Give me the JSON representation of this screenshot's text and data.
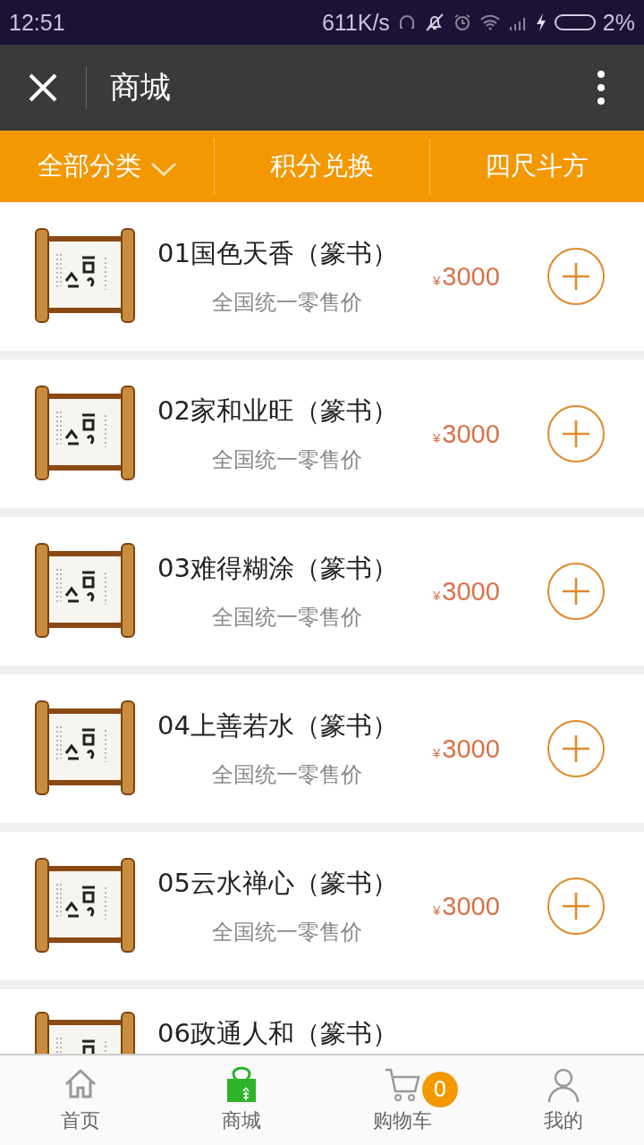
{
  "status_bar": {
    "time": "12:51",
    "speed": "611K/s",
    "battery": "2%"
  },
  "header": {
    "title": "商城"
  },
  "category_bar": [
    {
      "label": "全部分类",
      "kind": "dropdown"
    },
    {
      "label": "积分兑换",
      "kind": "link"
    },
    {
      "label": "四尺斗方",
      "kind": "link"
    }
  ],
  "products": [
    {
      "title": "01国色天香（篆书）",
      "subtitle": "全国统一零售价",
      "currency": "¥",
      "price": "3000"
    },
    {
      "title": "02家和业旺（篆书）",
      "subtitle": "全国统一零售价",
      "currency": "¥",
      "price": "3000"
    },
    {
      "title": "03难得糊涂（篆书）",
      "subtitle": "全国统一零售价",
      "currency": "¥",
      "price": "3000"
    },
    {
      "title": "04上善若水（篆书）",
      "subtitle": "全国统一零售价",
      "currency": "¥",
      "price": "3000"
    },
    {
      "title": "05云水禅心（篆书）",
      "subtitle": "全国统一零售价",
      "currency": "¥",
      "price": "3000"
    },
    {
      "title": "06政通人和（篆书）"
    }
  ],
  "bottom_nav": [
    {
      "label": "首页",
      "kind": "home",
      "selected": false
    },
    {
      "label": "商城",
      "kind": "shop",
      "selected": true
    },
    {
      "label": "购物车",
      "kind": "cart",
      "selected": false,
      "badge": "0"
    },
    {
      "label": "我的",
      "kind": "user",
      "selected": false
    }
  ]
}
